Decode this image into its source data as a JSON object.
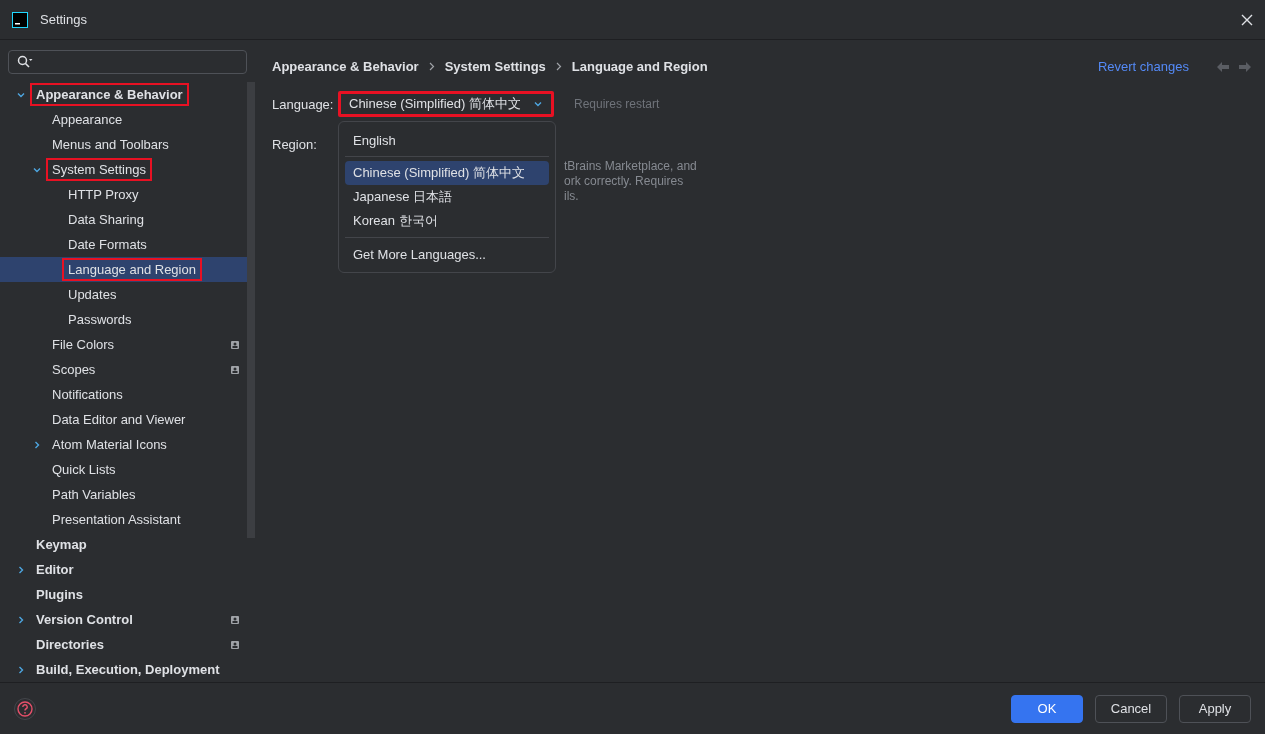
{
  "window": {
    "title": "Settings"
  },
  "tree": [
    {
      "label": "Appearance & Behavior",
      "expanded": true,
      "highlighted": true,
      "selected": false,
      "children": [
        {
          "label": "Appearance",
          "selected": false
        },
        {
          "label": "Menus and Toolbars",
          "selected": false
        },
        {
          "label": "System Settings",
          "expanded": true,
          "highlighted": true,
          "selected": false,
          "children": [
            {
              "label": "HTTP Proxy",
              "selected": false
            },
            {
              "label": "Data Sharing",
              "selected": false
            },
            {
              "label": "Date Formats",
              "selected": false
            },
            {
              "label": "Language and Region",
              "selected": true,
              "highlighted": true
            },
            {
              "label": "Updates",
              "selected": false
            },
            {
              "label": "Passwords",
              "selected": false
            }
          ]
        },
        {
          "label": "File Colors",
          "selected": false,
          "project_badge": true
        },
        {
          "label": "Scopes",
          "selected": false,
          "project_badge": true
        },
        {
          "label": "Notifications",
          "selected": false
        },
        {
          "label": "Data Editor and Viewer",
          "selected": false
        },
        {
          "label": "Atom Material Icons",
          "expanded": false,
          "selected": false
        },
        {
          "label": "Quick Lists",
          "selected": false
        },
        {
          "label": "Path Variables",
          "selected": false
        },
        {
          "label": "Presentation Assistant",
          "selected": false
        }
      ]
    },
    {
      "label": "Keymap",
      "selected": false
    },
    {
      "label": "Editor",
      "expanded": false,
      "selected": false
    },
    {
      "label": "Plugins",
      "selected": false
    },
    {
      "label": "Version Control",
      "expanded": false,
      "selected": false,
      "project_badge": true
    },
    {
      "label": "Directories",
      "selected": false,
      "project_badge": true
    },
    {
      "label": "Build, Execution, Deployment",
      "expanded": false,
      "selected": false
    }
  ],
  "breadcrumb": [
    "Appearance & Behavior",
    "System Settings",
    "Language and Region"
  ],
  "revert_link": "Revert changes",
  "language": {
    "label": "Language:",
    "value": "Chinese (Simplified) 简体中文",
    "highlighted": true,
    "note": "Requires restart",
    "options": [
      {
        "label": "English",
        "selected": false
      },
      {
        "label": "Chinese (Simplified) 简体中文",
        "selected": true
      },
      {
        "label": "Japanese 日本語",
        "selected": false
      },
      {
        "label": "Korean 한국어",
        "selected": false
      },
      {
        "label": "Get More Languages...",
        "selected": false
      }
    ]
  },
  "region": {
    "label": "Region:"
  },
  "hint_fragments": [
    "tBrains Marketplace, and",
    "ork correctly. Requires",
    "ils."
  ],
  "buttons": [
    {
      "label": "OK",
      "primary": true
    },
    {
      "label": "Cancel",
      "primary": false
    },
    {
      "label": "Apply",
      "primary": false
    }
  ]
}
